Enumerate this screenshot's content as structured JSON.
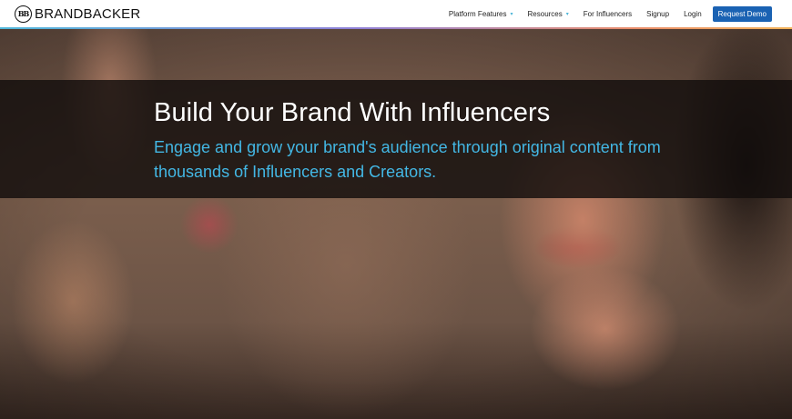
{
  "brand": {
    "mark": "BB",
    "name": "BRANDBACKER"
  },
  "nav": {
    "items": [
      {
        "label": "Platform Features",
        "dropdown": true
      },
      {
        "label": "Resources",
        "dropdown": true
      },
      {
        "label": "For Influencers",
        "dropdown": false
      },
      {
        "label": "Signup",
        "dropdown": false
      },
      {
        "label": "Login",
        "dropdown": false
      }
    ],
    "cta_label": "Request Demo"
  },
  "hero": {
    "title": "Build Your Brand With Influencers",
    "subtitle": "Engage and grow your brand's audience through original content from thousands of Influencers and Creators."
  },
  "colors": {
    "accent": "#43b7e4",
    "cta": "#1a62b3",
    "header_bg": "#ffffff"
  }
}
